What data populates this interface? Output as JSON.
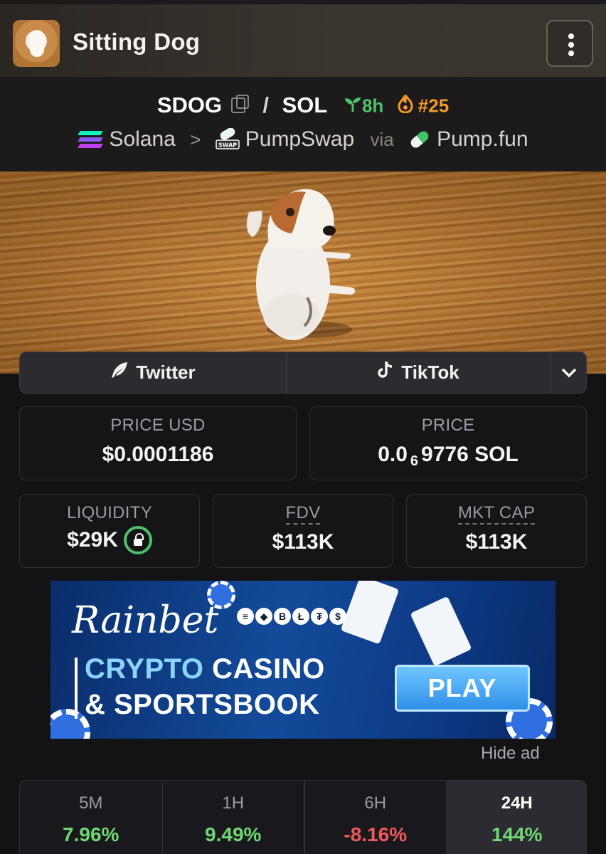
{
  "header": {
    "token_name": "Sitting Dog",
    "menu_icon": "kebab-menu-icon"
  },
  "pair": {
    "base": "SDOG",
    "separator": "/",
    "quote": "SOL",
    "age": "8h",
    "rank": "#25"
  },
  "chain": {
    "network": "Solana",
    "dex": "PumpSwap",
    "via_label": "via",
    "launchpad": "Pump.fun"
  },
  "socials": {
    "twitter_label": "Twitter",
    "tiktok_label": "TikTok"
  },
  "stats": {
    "price_usd_label": "PRICE USD",
    "price_usd_value": "$0.0001186",
    "price_label": "PRICE",
    "price_prefix": "0.0",
    "price_zeros": "6",
    "price_suffix": "9776 SOL",
    "liquidity_label": "LIQUIDITY",
    "liquidity_value": "$29K",
    "fdv_label": "FDV",
    "fdv_value": "$113K",
    "mcap_label": "MKT CAP",
    "mcap_value": "$113K"
  },
  "ad": {
    "brand": "Rainbet",
    "line1_a": "CRYPTO",
    "line1_b": "CASINO",
    "line2": "& SPORTSBOOK",
    "cta": "PLAY",
    "hide_label": "Hide ad"
  },
  "changes": [
    {
      "label": "5M",
      "value": "7.96%",
      "color": "#6fd873"
    },
    {
      "label": "1H",
      "value": "9.49%",
      "color": "#6fd873"
    },
    {
      "label": "6H",
      "value": "-8.16%",
      "color": "#f0585a"
    },
    {
      "label": "24H",
      "value": "144%",
      "color": "#6fd873"
    }
  ],
  "colors": {
    "positive": "#6fd873",
    "negative": "#f0585a",
    "age_green": "#4ec16a",
    "rank_orange": "#f59a2b"
  }
}
